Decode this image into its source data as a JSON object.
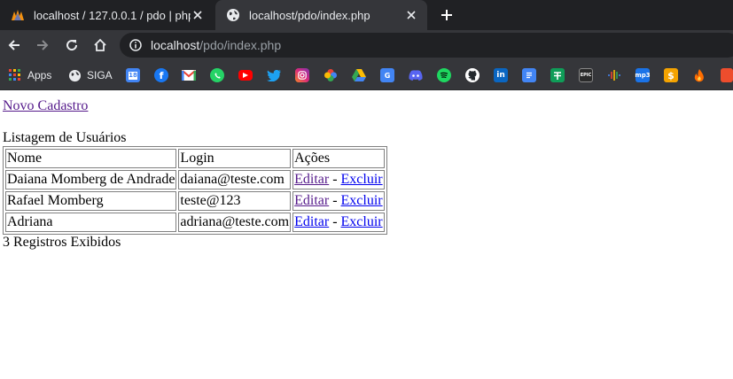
{
  "browser": {
    "tabs": [
      {
        "title": "localhost / 127.0.0.1 / pdo | phpMyAdmin",
        "active": false
      },
      {
        "title": "localhost/pdo/index.php",
        "active": true
      }
    ],
    "address": {
      "host": "localhost",
      "path": "/pdo/index.php"
    },
    "bookmarks": [
      {
        "label": "Apps",
        "icon": "apps-grid-icon"
      },
      {
        "label": "SIGA",
        "icon": "globe-icon"
      },
      {
        "label": "",
        "icon": "calendar-icon",
        "badge": "18"
      },
      {
        "label": "",
        "icon": "facebook-icon"
      },
      {
        "label": "",
        "icon": "gmail-icon"
      },
      {
        "label": "",
        "icon": "whatsapp-icon"
      },
      {
        "label": "",
        "icon": "youtube-icon"
      },
      {
        "label": "",
        "icon": "twitter-icon"
      },
      {
        "label": "",
        "icon": "instagram-icon"
      },
      {
        "label": "",
        "icon": "photos-icon"
      },
      {
        "label": "",
        "icon": "drive-icon"
      },
      {
        "label": "",
        "icon": "translate-icon"
      },
      {
        "label": "",
        "icon": "discord-icon"
      },
      {
        "label": "",
        "icon": "spotify-icon"
      },
      {
        "label": "",
        "icon": "github-icon"
      },
      {
        "label": "",
        "icon": "linkedin-icon"
      },
      {
        "label": "",
        "icon": "docs-icon"
      },
      {
        "label": "",
        "icon": "sheets-icon"
      },
      {
        "label": "",
        "icon": "epic-games-icon",
        "badge": "EPIC"
      },
      {
        "label": "",
        "icon": "podcasts-icon"
      },
      {
        "label": "",
        "icon": "mp3-icon",
        "badge": "mp3"
      },
      {
        "label": "",
        "icon": "dollar-icon",
        "badge": "$"
      },
      {
        "label": "",
        "icon": "flame-icon"
      },
      {
        "label": "",
        "icon": "shopping-bag-icon"
      }
    ]
  },
  "page": {
    "new_link": "Novo Cadastro",
    "list_title": "Listagem de Usuários",
    "table": {
      "headers": [
        "Nome",
        "Login",
        "Ações"
      ],
      "rows": [
        {
          "name": "Daiana Momberg de Andrade",
          "login": "daiana@teste.com"
        },
        {
          "name": "Rafael Momberg",
          "login": "teste@123"
        },
        {
          "name": "Adriana",
          "login": "adriana@teste.com"
        }
      ],
      "edit_label": "Editar",
      "separator": " - ",
      "delete_label": "Excluir"
    },
    "count_text": "3 Registros Exibidos"
  },
  "colors": {
    "chrome_dark": "#202124",
    "chrome_toolbar": "#35363a",
    "link_visited": "#551a8b",
    "link_unvisited": "#0000ee"
  }
}
